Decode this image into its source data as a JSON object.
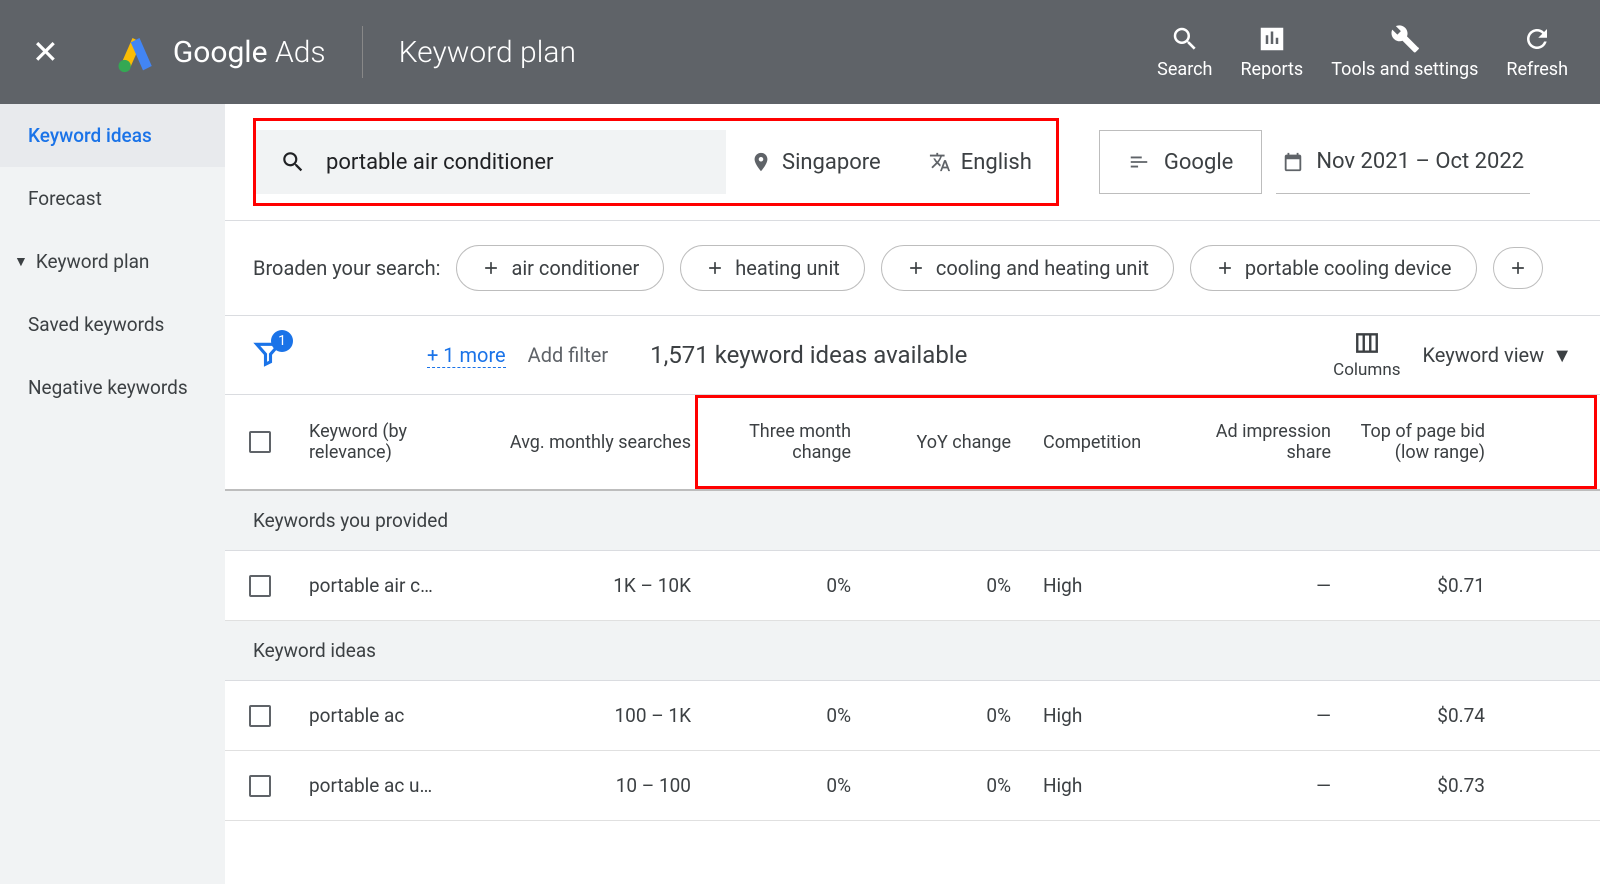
{
  "header": {
    "product_bold": "Google",
    "product_light": "Ads",
    "page_title": "Keyword plan",
    "actions": {
      "search": "Search",
      "reports": "Reports",
      "tools": "Tools and settings",
      "refresh": "Refresh"
    }
  },
  "sidebar": [
    {
      "label": "Keyword ideas",
      "active": true
    },
    {
      "label": "Forecast"
    },
    {
      "label": "Keyword plan",
      "caret": true
    },
    {
      "label": "Saved keywords"
    },
    {
      "label": "Negative keywords"
    }
  ],
  "filters": {
    "search_term": "portable air conditioner",
    "location": "Singapore",
    "language": "English",
    "network": "Google",
    "date_range": "Nov 2021 – Oct 2022"
  },
  "broaden": {
    "label": "Broaden your search:",
    "chips": [
      "air conditioner",
      "heating unit",
      "cooling and heating unit",
      "portable cooling device"
    ]
  },
  "toolbar": {
    "funnel_badge": "1",
    "more": "+ 1 more",
    "add_filter": "Add filter",
    "ideas_available": "1,571 keyword ideas available",
    "columns": "Columns",
    "keyword_view": "Keyword view"
  },
  "columns": {
    "keyword": "Keyword (by relevance)",
    "avg": "Avg. monthly searches",
    "tmc": "Three month change",
    "yoy": "YoY change",
    "comp": "Competition",
    "imp": "Ad impression share",
    "bid": "Top of page bid (low range)"
  },
  "sections": {
    "provided": "Keywords you provided",
    "ideas": "Keyword ideas"
  },
  "rows_provided": [
    {
      "kw": "portable air c…",
      "avg": "1K – 10K",
      "tmc": "0%",
      "yoy": "0%",
      "comp": "High",
      "imp": "—",
      "bid": "$0.71"
    }
  ],
  "rows_ideas": [
    {
      "kw": "portable ac",
      "avg": "100 – 1K",
      "tmc": "0%",
      "yoy": "0%",
      "comp": "High",
      "imp": "—",
      "bid": "$0.74"
    },
    {
      "kw": "portable ac u…",
      "avg": "10 – 100",
      "tmc": "0%",
      "yoy": "0%",
      "comp": "High",
      "imp": "—",
      "bid": "$0.73"
    }
  ]
}
